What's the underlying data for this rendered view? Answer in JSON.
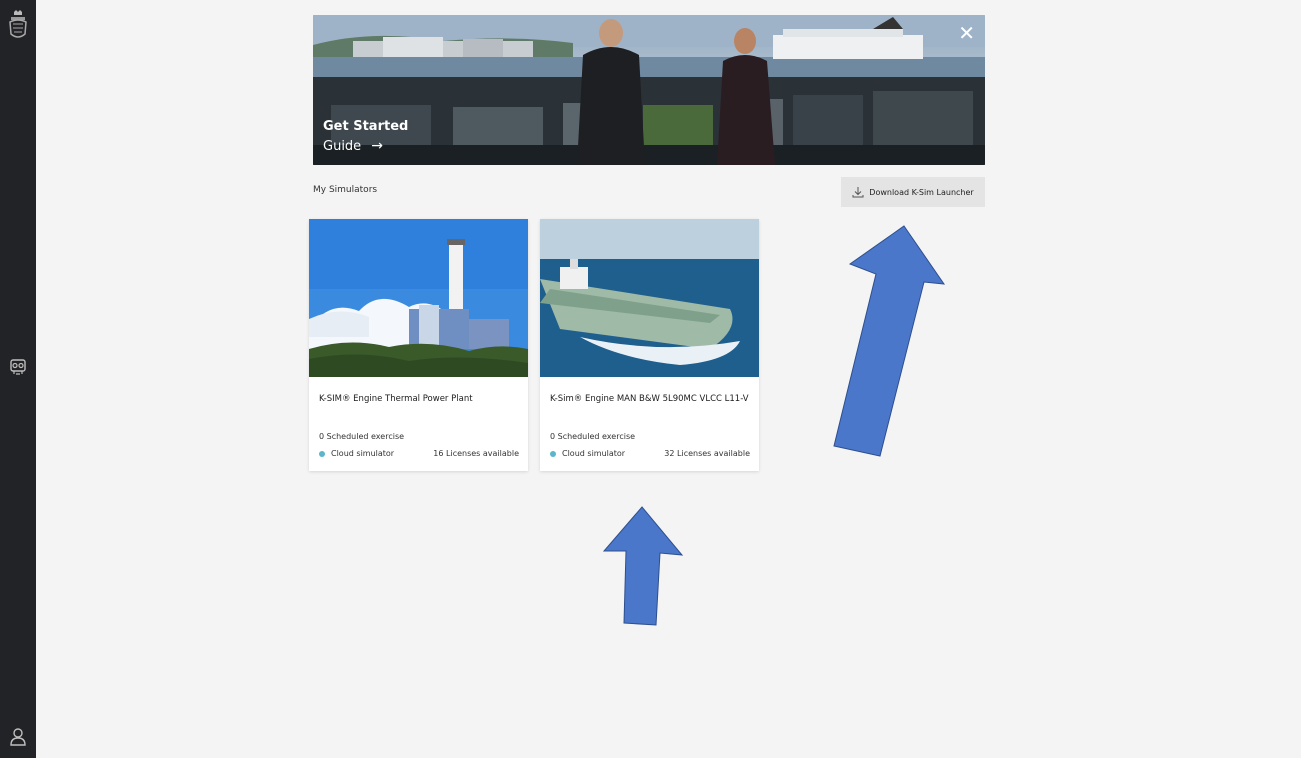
{
  "hero": {
    "title": "Get Started",
    "guide_label": "Guide",
    "guide_arrow": "→",
    "close_glyph": "✕"
  },
  "section": {
    "title": "My Simulators"
  },
  "download": {
    "label": "Download K-Sim Launcher",
    "icon": "download-icon"
  },
  "simulators": [
    {
      "name": "K-SIM® Engine Thermal Power Plant",
      "scheduled": "0 Scheduled exercise",
      "type": "Cloud simulator",
      "licenses": "16 Licenses available",
      "status_color": "#5ab6c9"
    },
    {
      "name": "K-Sim® Engine MAN B&W 5L90MC VLCC L11-V",
      "scheduled": "0 Scheduled exercise",
      "type": "Cloud simulator",
      "licenses": "32 Licenses available",
      "status_color": "#5ab6c9"
    }
  ],
  "colors": {
    "sidebar": "#222326",
    "background": "#f4f4f4",
    "annotation_arrow": "#4a77c9"
  }
}
